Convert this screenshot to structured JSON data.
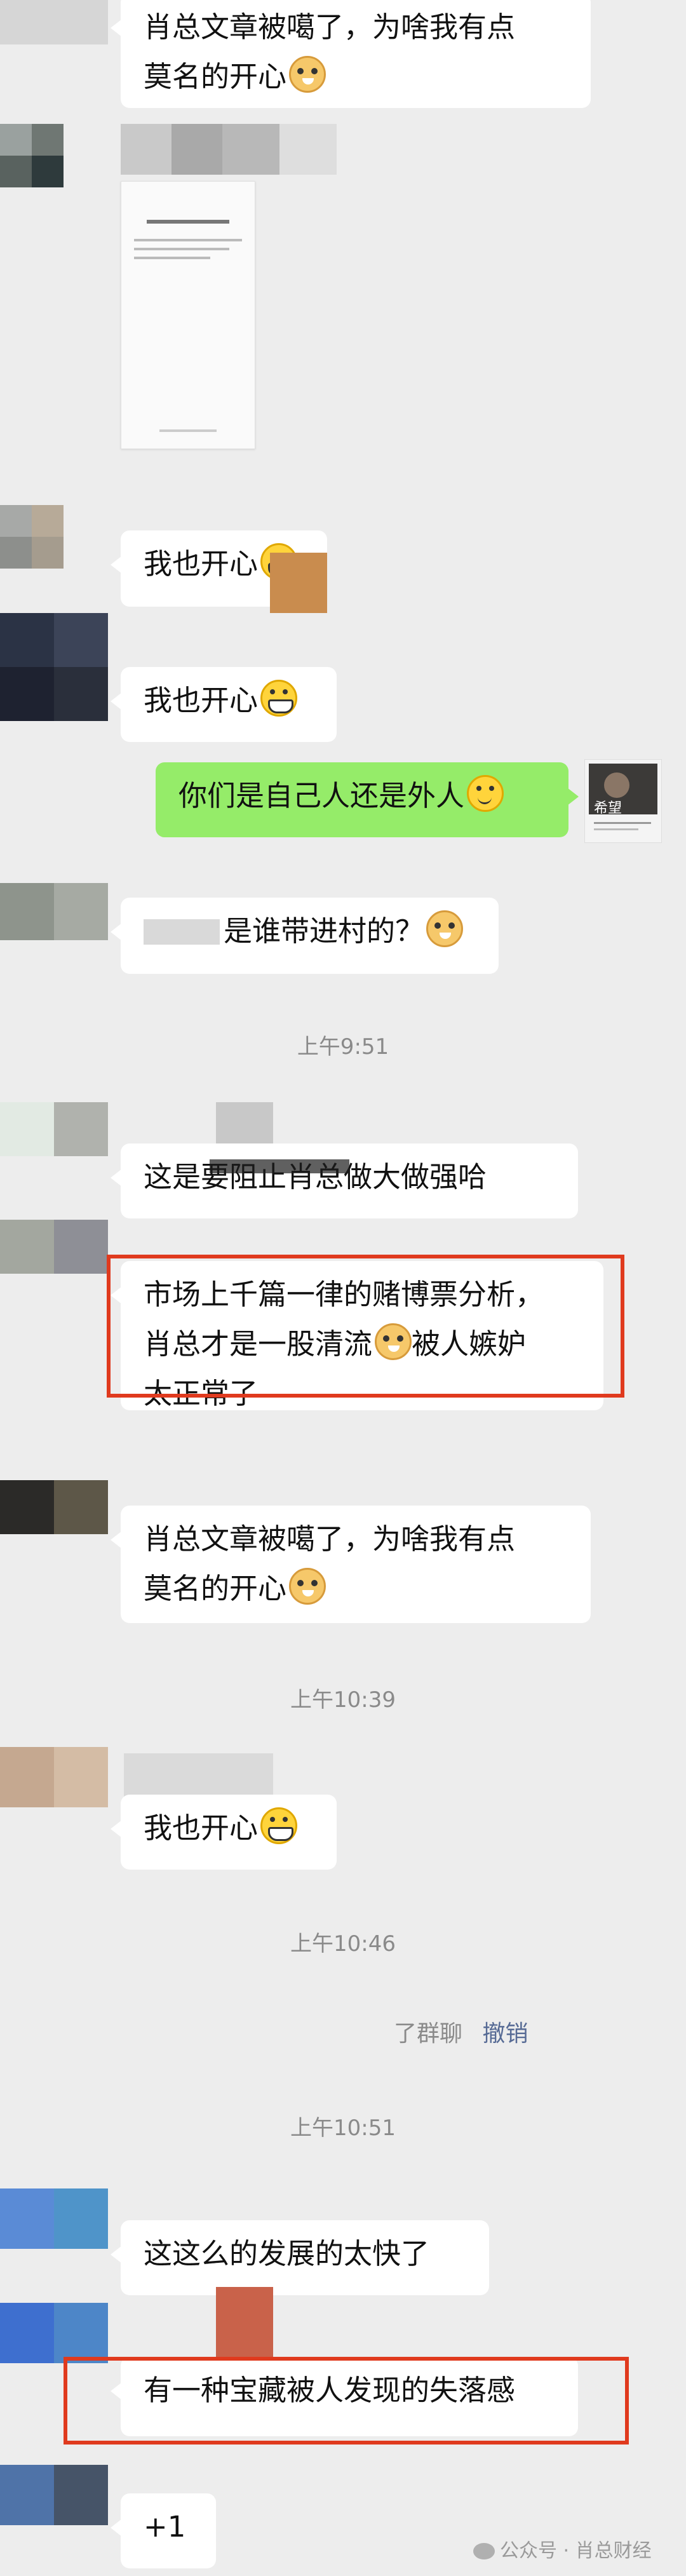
{
  "messages": {
    "m1_line1": "肖总文章被噶了，为啥我有点",
    "m1_line2": "莫名的开心",
    "m2": "我也开心",
    "m3": "我也开心",
    "m4": "你们是自己人还是外人",
    "m5": "是谁带进村的？",
    "m6": "这是要阻止肖总做大做强哈",
    "m7_line1": "市场上千篇一律的赌博票分析，",
    "m7_line2": "肖总才是一股清流",
    "m7_line2b": "被人嫉妒",
    "m7_line3": "太正常了",
    "m8_line1": "肖总文章被噶了，为啥我有点",
    "m8_line2": "莫名的开心",
    "m9": "我也开心",
    "m10": "这这么的发展的太快了",
    "m11": "有一种宝藏被人发现的失落感",
    "m12": "+1"
  },
  "times": {
    "t1": "上午9:51",
    "t2": "上午10:39",
    "t3": "上午10:46",
    "t4": "上午10:51"
  },
  "system": {
    "recall_text": "了群聊",
    "recall_action": "撤销"
  },
  "sticker": {
    "caption": "希望"
  },
  "watermark": "公众号 · 肖总财经",
  "colors": {
    "background": "#ededed",
    "bubble_self": "#95ec69",
    "highlight": "#e03a1e",
    "recall_link": "#576b95"
  }
}
